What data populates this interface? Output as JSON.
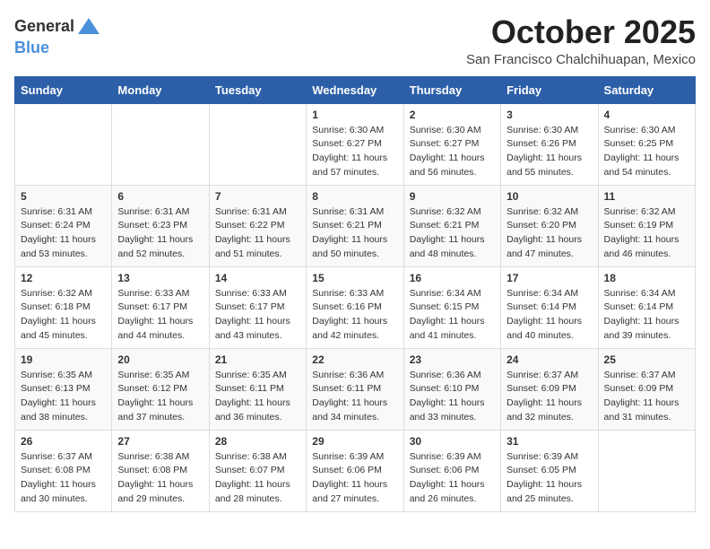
{
  "header": {
    "logo_general": "General",
    "logo_blue": "Blue",
    "month": "October 2025",
    "location": "San Francisco Chalchihuapan, Mexico"
  },
  "days_of_week": [
    "Sunday",
    "Monday",
    "Tuesday",
    "Wednesday",
    "Thursday",
    "Friday",
    "Saturday"
  ],
  "weeks": [
    [
      {
        "day": "",
        "info": ""
      },
      {
        "day": "",
        "info": ""
      },
      {
        "day": "",
        "info": ""
      },
      {
        "day": "1",
        "info": "Sunrise: 6:30 AM\nSunset: 6:27 PM\nDaylight: 11 hours and 57 minutes."
      },
      {
        "day": "2",
        "info": "Sunrise: 6:30 AM\nSunset: 6:27 PM\nDaylight: 11 hours and 56 minutes."
      },
      {
        "day": "3",
        "info": "Sunrise: 6:30 AM\nSunset: 6:26 PM\nDaylight: 11 hours and 55 minutes."
      },
      {
        "day": "4",
        "info": "Sunrise: 6:30 AM\nSunset: 6:25 PM\nDaylight: 11 hours and 54 minutes."
      }
    ],
    [
      {
        "day": "5",
        "info": "Sunrise: 6:31 AM\nSunset: 6:24 PM\nDaylight: 11 hours and 53 minutes."
      },
      {
        "day": "6",
        "info": "Sunrise: 6:31 AM\nSunset: 6:23 PM\nDaylight: 11 hours and 52 minutes."
      },
      {
        "day": "7",
        "info": "Sunrise: 6:31 AM\nSunset: 6:22 PM\nDaylight: 11 hours and 51 minutes."
      },
      {
        "day": "8",
        "info": "Sunrise: 6:31 AM\nSunset: 6:21 PM\nDaylight: 11 hours and 50 minutes."
      },
      {
        "day": "9",
        "info": "Sunrise: 6:32 AM\nSunset: 6:21 PM\nDaylight: 11 hours and 48 minutes."
      },
      {
        "day": "10",
        "info": "Sunrise: 6:32 AM\nSunset: 6:20 PM\nDaylight: 11 hours and 47 minutes."
      },
      {
        "day": "11",
        "info": "Sunrise: 6:32 AM\nSunset: 6:19 PM\nDaylight: 11 hours and 46 minutes."
      }
    ],
    [
      {
        "day": "12",
        "info": "Sunrise: 6:32 AM\nSunset: 6:18 PM\nDaylight: 11 hours and 45 minutes."
      },
      {
        "day": "13",
        "info": "Sunrise: 6:33 AM\nSunset: 6:17 PM\nDaylight: 11 hours and 44 minutes."
      },
      {
        "day": "14",
        "info": "Sunrise: 6:33 AM\nSunset: 6:17 PM\nDaylight: 11 hours and 43 minutes."
      },
      {
        "day": "15",
        "info": "Sunrise: 6:33 AM\nSunset: 6:16 PM\nDaylight: 11 hours and 42 minutes."
      },
      {
        "day": "16",
        "info": "Sunrise: 6:34 AM\nSunset: 6:15 PM\nDaylight: 11 hours and 41 minutes."
      },
      {
        "day": "17",
        "info": "Sunrise: 6:34 AM\nSunset: 6:14 PM\nDaylight: 11 hours and 40 minutes."
      },
      {
        "day": "18",
        "info": "Sunrise: 6:34 AM\nSunset: 6:14 PM\nDaylight: 11 hours and 39 minutes."
      }
    ],
    [
      {
        "day": "19",
        "info": "Sunrise: 6:35 AM\nSunset: 6:13 PM\nDaylight: 11 hours and 38 minutes."
      },
      {
        "day": "20",
        "info": "Sunrise: 6:35 AM\nSunset: 6:12 PM\nDaylight: 11 hours and 37 minutes."
      },
      {
        "day": "21",
        "info": "Sunrise: 6:35 AM\nSunset: 6:11 PM\nDaylight: 11 hours and 36 minutes."
      },
      {
        "day": "22",
        "info": "Sunrise: 6:36 AM\nSunset: 6:11 PM\nDaylight: 11 hours and 34 minutes."
      },
      {
        "day": "23",
        "info": "Sunrise: 6:36 AM\nSunset: 6:10 PM\nDaylight: 11 hours and 33 minutes."
      },
      {
        "day": "24",
        "info": "Sunrise: 6:37 AM\nSunset: 6:09 PM\nDaylight: 11 hours and 32 minutes."
      },
      {
        "day": "25",
        "info": "Sunrise: 6:37 AM\nSunset: 6:09 PM\nDaylight: 11 hours and 31 minutes."
      }
    ],
    [
      {
        "day": "26",
        "info": "Sunrise: 6:37 AM\nSunset: 6:08 PM\nDaylight: 11 hours and 30 minutes."
      },
      {
        "day": "27",
        "info": "Sunrise: 6:38 AM\nSunset: 6:08 PM\nDaylight: 11 hours and 29 minutes."
      },
      {
        "day": "28",
        "info": "Sunrise: 6:38 AM\nSunset: 6:07 PM\nDaylight: 11 hours and 28 minutes."
      },
      {
        "day": "29",
        "info": "Sunrise: 6:39 AM\nSunset: 6:06 PM\nDaylight: 11 hours and 27 minutes."
      },
      {
        "day": "30",
        "info": "Sunrise: 6:39 AM\nSunset: 6:06 PM\nDaylight: 11 hours and 26 minutes."
      },
      {
        "day": "31",
        "info": "Sunrise: 6:39 AM\nSunset: 6:05 PM\nDaylight: 11 hours and 25 minutes."
      },
      {
        "day": "",
        "info": ""
      }
    ]
  ]
}
